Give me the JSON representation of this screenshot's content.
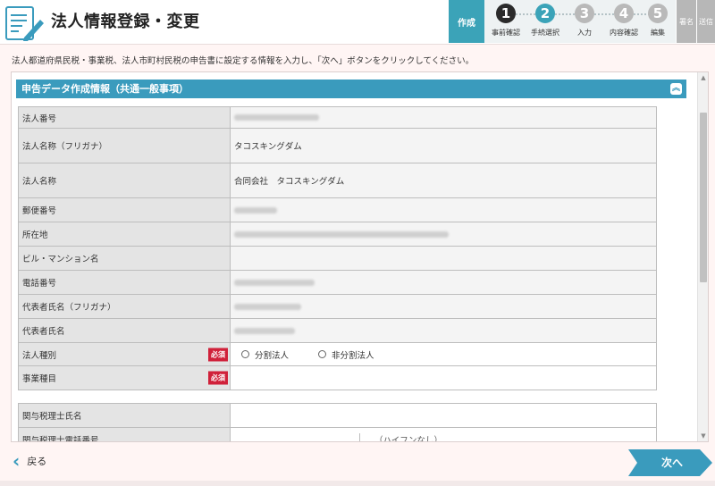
{
  "header": {
    "title": "法人情報登録・変更"
  },
  "steps": {
    "current_label": "作成",
    "items": [
      {
        "num": "1",
        "label": "事前確認",
        "color": "#2b2b2b"
      },
      {
        "num": "2",
        "label": "手続選択",
        "color": "#3ba3b8"
      },
      {
        "num": "3",
        "label": "入力",
        "color": "#b9b9b9"
      },
      {
        "num": "4",
        "label": "内容確認",
        "color": "#b9b9b9"
      },
      {
        "num": "5",
        "label": "編集",
        "color": "#b9b9b9"
      }
    ],
    "extra": [
      "署名",
      "送信"
    ]
  },
  "instruction": "法人都道府県民税・事業税、法人市町村民税の申告書に設定する情報を入力し、「次へ」ボタンをクリックしてください。",
  "section": {
    "title": "申告データ作成情報（共通一般事項）",
    "collapse_icon": "chevron-double-up-icon"
  },
  "form": {
    "rows": [
      {
        "label": "法人番号",
        "value": ""
      },
      {
        "label": "法人名称（フリガナ）",
        "value": "タコスキングダム"
      },
      {
        "label": "法人名称",
        "value": "合同会社　タコスキングダム"
      },
      {
        "label": "郵便番号",
        "value": ""
      },
      {
        "label": "所在地",
        "value": ""
      },
      {
        "label": "ビル・マンション名",
        "value": ""
      },
      {
        "label": "電話番号",
        "value": ""
      },
      {
        "label": "代表者氏名（フリガナ）",
        "value": ""
      },
      {
        "label": "代表者氏名",
        "value": ""
      },
      {
        "label": "法人種別",
        "required": "必須",
        "options": [
          "分割法人",
          "非分割法人"
        ]
      },
      {
        "label": "事業種目",
        "required": "必須",
        "value": ""
      }
    ],
    "rows2": [
      {
        "label": "関与税理士氏名",
        "value": ""
      },
      {
        "label": "関与税理士電話番号",
        "note": "（ハイフンなし）"
      }
    ]
  },
  "footer": {
    "back_label": "戻る",
    "next_label": "次へ"
  },
  "colors": {
    "accent": "#3a9bbd",
    "required": "#d0213a",
    "background": "#fff5f4"
  }
}
